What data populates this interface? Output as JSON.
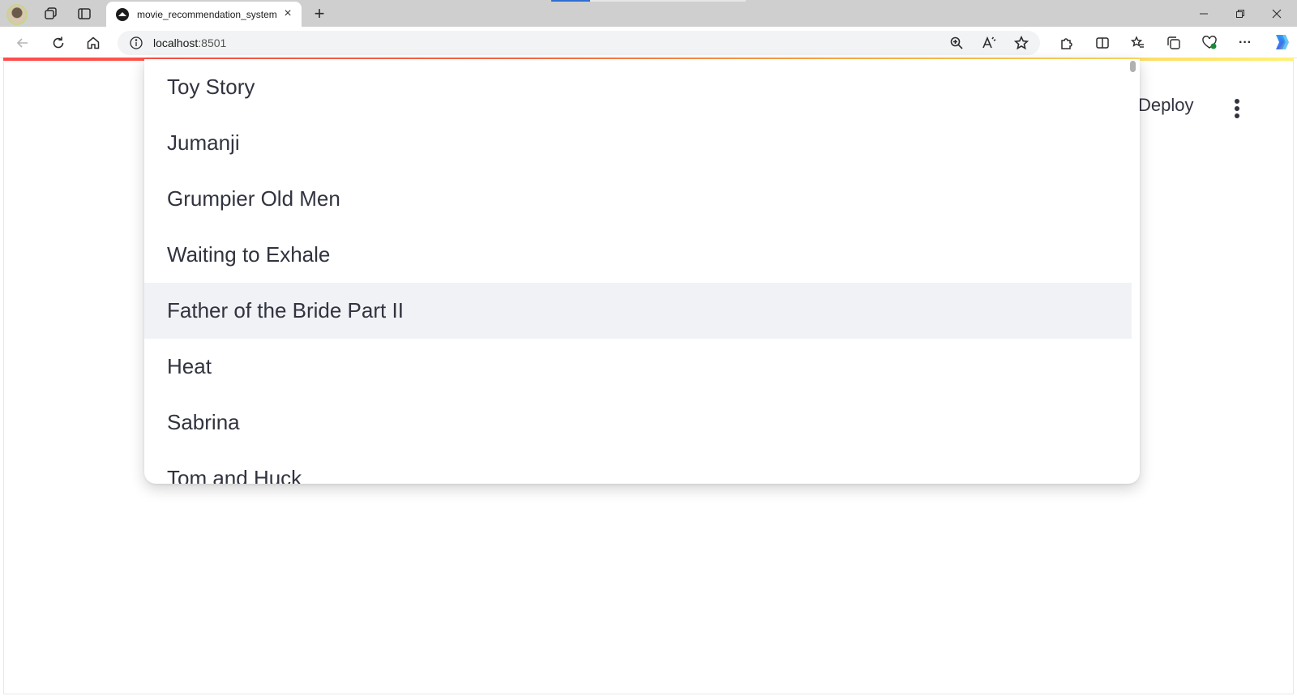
{
  "browser": {
    "tab_title": "movie_recommendation_system",
    "url_host": "localhost",
    "url_port": ":8501",
    "new_tab_symbol": "+",
    "tab_close_symbol": "×"
  },
  "app": {
    "deploy_label": "Deploy"
  },
  "dropdown": {
    "options": [
      "Toy Story",
      "Jumanji",
      "Grumpier Old Men",
      "Waiting to Exhale",
      "Father of the Bride Part II",
      "Heat",
      "Sabrina",
      "Tom and Huck"
    ],
    "highlighted_option": "Father of the Bride Part II"
  },
  "colors": {
    "accent_gradient_start": "#ff4b4b",
    "accent_gradient_end": "#fff176",
    "text": "#31333f",
    "highlight": "#f0f2f6"
  }
}
